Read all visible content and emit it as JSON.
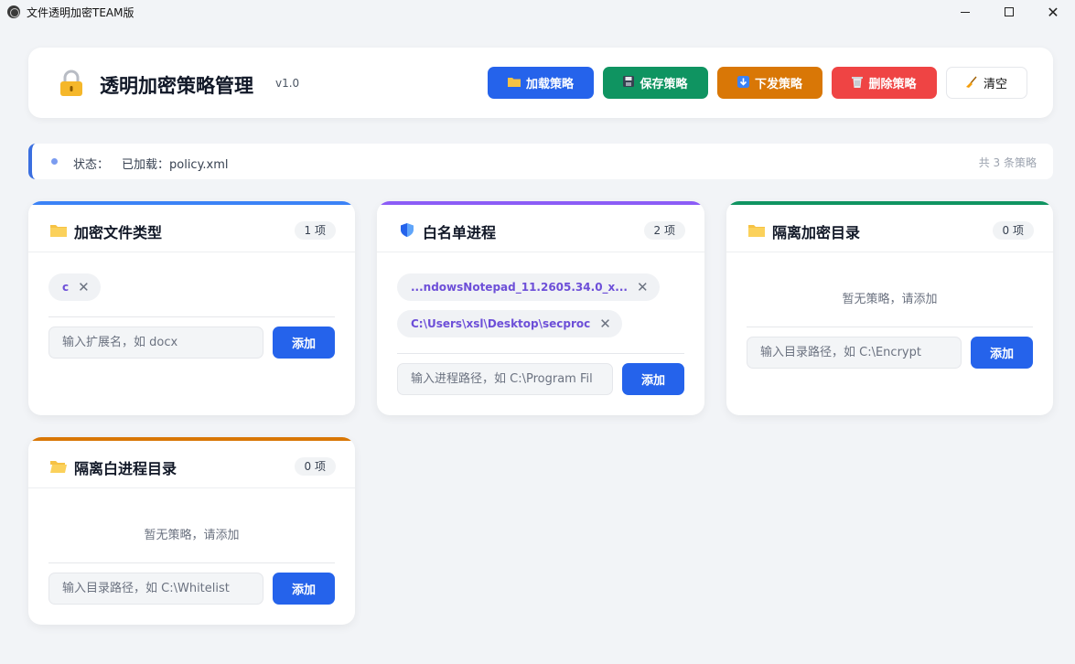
{
  "window": {
    "title": "文件透明加密TEAM版",
    "min": "",
    "max": "",
    "close": "✕"
  },
  "header": {
    "app_name": "透明加密策略管理",
    "version": "v1.0",
    "buttons": {
      "load": {
        "icon": "folder-icon",
        "label": "加载策略"
      },
      "save": {
        "icon": "floppy-icon",
        "label": "保存策略"
      },
      "push": {
        "icon": "download-icon",
        "label": "下发策略"
      },
      "delete": {
        "icon": "wastebasket-icon",
        "label": "删除策略"
      },
      "clear": {
        "icon": "broom-icon",
        "label": "清空"
      }
    }
  },
  "status": {
    "label": "状态：",
    "value": "已加载：policy.xml",
    "count": "共 3 条策略"
  },
  "cards": {
    "ext": {
      "title": "加密文件类型",
      "count": "1 项",
      "accent": "#3b82f6",
      "tags": [
        "c"
      ],
      "placeholder": "输入扩展名，如 docx",
      "add": "添加"
    },
    "whitelist": {
      "title": "白名单进程",
      "count": "2 项",
      "accent": "#8b5cf6",
      "tags": [
        "...ndowsNotepad_11.2605.34.0_x...",
        "C:\\Users\\xsl\\Desktop\\secproc"
      ],
      "placeholder": "输入进程路径，如 C:\\Program Fil",
      "add": "添加"
    },
    "iso_dir": {
      "title": "隔离加密目录",
      "count": "0 项",
      "accent": "#0f9461",
      "empty": "暂无策略，请添加",
      "placeholder": "输入目录路径，如 C:\\Encrypt",
      "add": "添加"
    },
    "iso_proc": {
      "title": "隔离白进程目录",
      "count": "0 项",
      "accent": "#d97706",
      "empty": "暂无策略，请添加",
      "placeholder": "输入目录路径，如 C:\\Whitelist",
      "add": "添加"
    }
  }
}
